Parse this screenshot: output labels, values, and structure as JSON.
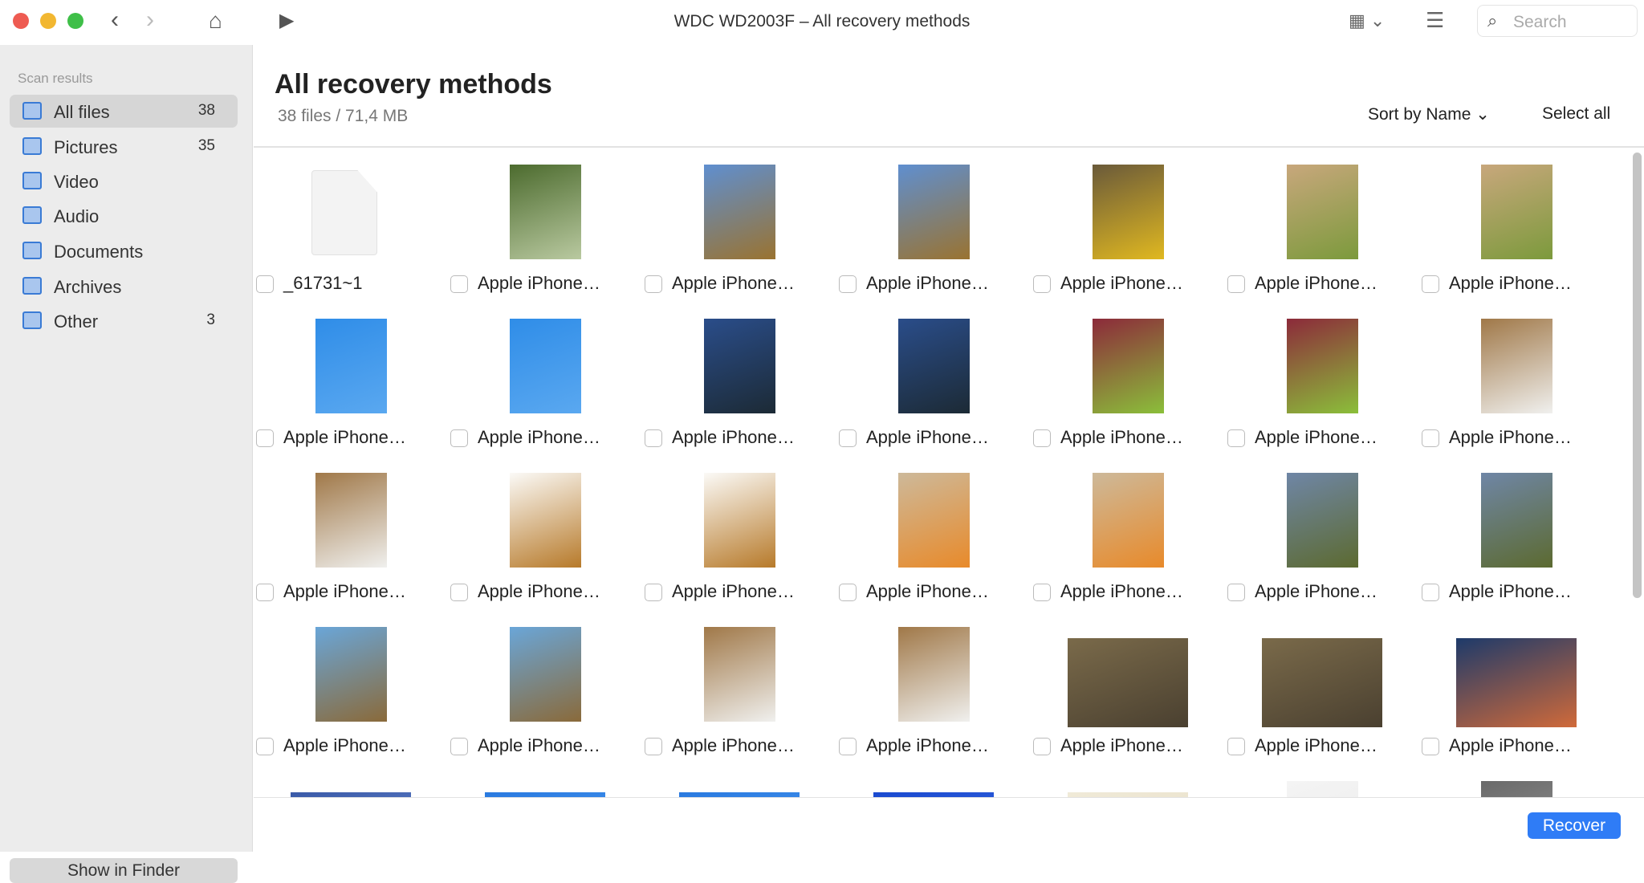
{
  "window": {
    "title": "WDC WD2003F – All recovery methods",
    "search_placeholder": "Search"
  },
  "sidebar": {
    "heading": "Scan results",
    "items": [
      {
        "label": "All files",
        "count": "38",
        "selected": true,
        "icon": "stack-icon"
      },
      {
        "label": "Pictures",
        "count": "35",
        "icon": "picture-icon"
      },
      {
        "label": "Video",
        "count": "",
        "icon": "film-icon"
      },
      {
        "label": "Audio",
        "count": "",
        "icon": "music-note-icon"
      },
      {
        "label": "Documents",
        "count": "",
        "icon": "document-icon"
      },
      {
        "label": "Archives",
        "count": "",
        "icon": "archive-icon"
      },
      {
        "label": "Other",
        "count": "3",
        "icon": "stack-icon"
      }
    ],
    "show_in_finder": "Show in Finder"
  },
  "main": {
    "title": "All recovery methods",
    "subtitle": "38 files / 71,4 MB",
    "sort_label": "Sort by Name",
    "select_all": "Select all",
    "recover": "Recover"
  },
  "accent": "#2f7cf6",
  "files": [
    {
      "name": "_61731~1",
      "kind": "file",
      "c": [
        "#f3f3f3",
        "#f3f3f3"
      ]
    },
    {
      "name": "Apple iPhone…",
      "c": [
        "#4c6b2e",
        "#b9c9a0"
      ]
    },
    {
      "name": "Apple iPhone…",
      "c": [
        "#5f8fd0",
        "#9a7330"
      ]
    },
    {
      "name": "Apple iPhone…",
      "c": [
        "#5f8fd0",
        "#9a7330"
      ]
    },
    {
      "name": "Apple iPhone…",
      "c": [
        "#6a5a3a",
        "#e0b820"
      ]
    },
    {
      "name": "Apple iPhone…",
      "c": [
        "#c8a77c",
        "#7c9a3c"
      ]
    },
    {
      "name": "Apple iPhone…",
      "c": [
        "#c8a77c",
        "#7c9a3c"
      ]
    },
    {
      "name": "Apple iPhone…",
      "c": [
        "#2f8de8",
        "#5aa8f0"
      ]
    },
    {
      "name": "Apple iPhone…",
      "c": [
        "#2f8de8",
        "#5aa8f0"
      ]
    },
    {
      "name": "Apple iPhone…",
      "c": [
        "#2a4d8a",
        "#1c2a35"
      ]
    },
    {
      "name": "Apple iPhone…",
      "c": [
        "#2a4d8a",
        "#1c2a35"
      ]
    },
    {
      "name": "Apple iPhone…",
      "c": [
        "#8c2a3a",
        "#8bbf3a"
      ]
    },
    {
      "name": "Apple iPhone…",
      "c": [
        "#8c2a3a",
        "#8bbf3a"
      ]
    },
    {
      "name": "Apple iPhone…",
      "c": [
        "#a07848",
        "#f0f0ee"
      ]
    },
    {
      "name": "Apple iPhone…",
      "c": [
        "#a07848",
        "#f0f0ee"
      ]
    },
    {
      "name": "Apple iPhone…",
      "c": [
        "#fbfaf7",
        "#b77a2a"
      ]
    },
    {
      "name": "Apple iPhone…",
      "c": [
        "#fbfaf7",
        "#b77a2a"
      ]
    },
    {
      "name": "Apple iPhone…",
      "c": [
        "#cdb99a",
        "#e88a2a"
      ]
    },
    {
      "name": "Apple iPhone…",
      "c": [
        "#cdb99a",
        "#e88a2a"
      ]
    },
    {
      "name": "Apple iPhone…",
      "c": [
        "#6f86a6",
        "#5c6a30"
      ]
    },
    {
      "name": "Apple iPhone…",
      "c": [
        "#6f86a6",
        "#5c6a30"
      ]
    },
    {
      "name": "Apple iPhone…",
      "c": [
        "#6aa6d8",
        "#8a6a3a"
      ]
    },
    {
      "name": "Apple iPhone…",
      "c": [
        "#6aa6d8",
        "#8a6a3a"
      ]
    },
    {
      "name": "Apple iPhone…",
      "c": [
        "#a07848",
        "#f0f0ee"
      ]
    },
    {
      "name": "Apple iPhone…",
      "c": [
        "#a07848",
        "#f0f0ee"
      ]
    },
    {
      "name": "Apple iPhone…",
      "land": true,
      "c": [
        "#7a6a4a",
        "#4a4030"
      ]
    },
    {
      "name": "Apple iPhone…",
      "land": true,
      "c": [
        "#7a6a4a",
        "#4a4030"
      ]
    },
    {
      "name": "Apple iPhone…",
      "land": true,
      "c": [
        "#1d3a6a",
        "#d06a3a"
      ]
    },
    {
      "name": "",
      "land": true,
      "c": [
        "#3a5aa8",
        "#6a8ad0"
      ]
    },
    {
      "name": "",
      "land": true,
      "c": [
        "#2a7ae0",
        "#4a9af0"
      ]
    },
    {
      "name": "",
      "land": true,
      "c": [
        "#2a7ae0",
        "#4a9af0"
      ]
    },
    {
      "name": "",
      "land": true,
      "c": [
        "#1a4ad0",
        "#3a6ae0"
      ]
    },
    {
      "name": "",
      "land": true,
      "c": [
        "#f0ead8",
        "#e6dcc4"
      ]
    },
    {
      "name": "",
      "c": [
        "#f4f4f4",
        "#eaeaea"
      ]
    },
    {
      "name": "",
      "c": [
        "#6a6a6a",
        "#9a9a9a"
      ]
    }
  ]
}
